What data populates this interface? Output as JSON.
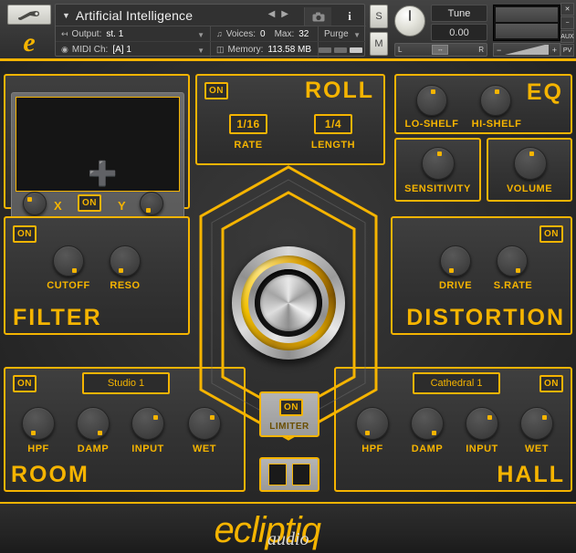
{
  "header": {
    "instrument_title": "Artificial Intelligence",
    "output_label": "Output:",
    "output_value": "st. 1",
    "midi_label": "MIDI Ch:",
    "midi_value": "[A] 1",
    "voices_label": "Voices:",
    "voices_value": "0",
    "max_label": "Max:",
    "max_value": "32",
    "memory_label": "Memory:",
    "memory_value": "113.58 MB",
    "purge_label": "Purge",
    "solo_label": "S",
    "mute_label": "M",
    "tune_label": "Tune",
    "tune_value": "0.00",
    "pan_left": "L",
    "pan_center": "↔",
    "pan_right": "R",
    "vol_minus": "−",
    "vol_plus": "+",
    "wrench_icon": "wrench-icon",
    "logo_icon": "ecliptiq-e-logo",
    "camera_icon": "camera-icon",
    "info_icon": "info-icon",
    "prev_icon": "◀",
    "next_icon": "▶",
    "side_buttons": [
      {
        "name": "close",
        "label": "✕"
      },
      {
        "name": "minimize",
        "label": "−"
      },
      {
        "name": "aux",
        "label": "AUX"
      },
      {
        "name": "pv",
        "label": "PV"
      }
    ]
  },
  "xy": {
    "on_label": "ON",
    "x_label": "X",
    "y_label": "Y",
    "cursor_icon": "crosshair-cursor",
    "x_knob_angle": -50,
    "y_knob_angle": 215
  },
  "roll": {
    "section_name": "ROLL",
    "on_label": "ON",
    "rate_value": "1/16",
    "rate_label": "RATE",
    "length_value": "1/4",
    "length_label": "LENGTH"
  },
  "eq": {
    "section_name": "EQ",
    "knobs": [
      {
        "label": "LO-SHELF",
        "angle": 0
      },
      {
        "label": "HI-SHELF",
        "angle": 0
      }
    ]
  },
  "sensitivity": {
    "label": "SENSITIVITY",
    "angle": 0
  },
  "volume": {
    "label": "VOLUME",
    "angle": 0
  },
  "filter": {
    "section_name": "FILTER",
    "on_label": "ON",
    "knobs": [
      {
        "label": "CUTOFF",
        "angle": 150
      },
      {
        "label": "RESO",
        "angle": 210
      }
    ]
  },
  "distortion": {
    "section_name": "DISTORTION",
    "on_label": "ON",
    "knobs": [
      {
        "label": "DRIVE",
        "angle": 210
      },
      {
        "label": "S.RATE",
        "angle": 150
      }
    ]
  },
  "room": {
    "section_name": "ROOM",
    "on_label": "ON",
    "preset": "Studio 1",
    "knobs": [
      {
        "label": "HPF",
        "angle": 215
      },
      {
        "label": "DAMP",
        "angle": 145
      },
      {
        "label": "INPUT",
        "angle": 45
      },
      {
        "label": "WET",
        "angle": 45
      }
    ]
  },
  "hall": {
    "section_name": "HALL",
    "on_label": "ON",
    "preset": "Cathedral 1",
    "knobs": [
      {
        "label": "HPF",
        "angle": 215
      },
      {
        "label": "DAMP",
        "angle": 145
      },
      {
        "label": "INPUT",
        "angle": 45
      },
      {
        "label": "WET",
        "angle": 45
      }
    ]
  },
  "limiter": {
    "on_label": "ON",
    "label": "LIMITER"
  },
  "footer": {
    "brand": "ecliptiq",
    "sub_brand": "audio"
  },
  "colors": {
    "accent": "#f5b400",
    "panel_bg": "#353535",
    "body_bg": "#2b2b2b"
  }
}
